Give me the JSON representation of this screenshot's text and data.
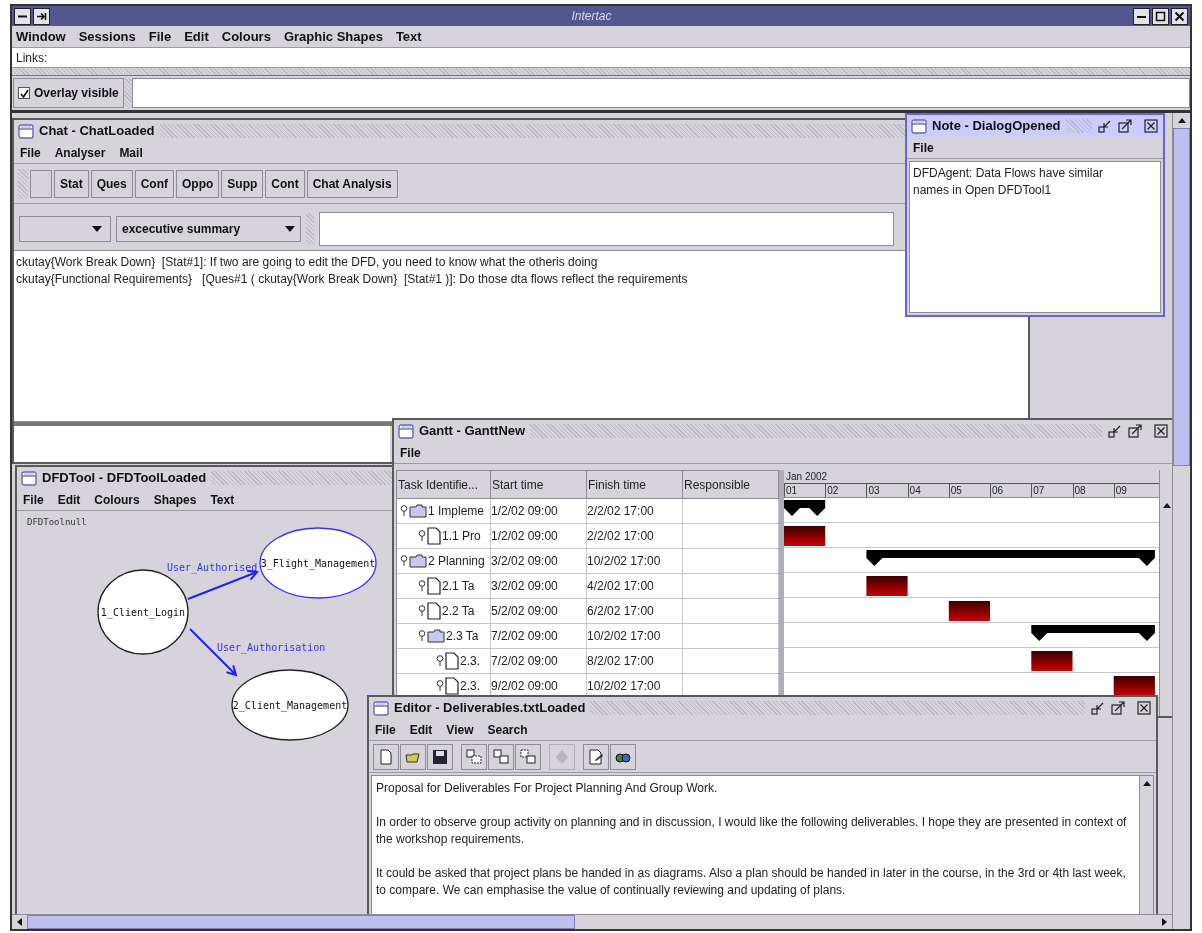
{
  "window": {
    "title": "Intertac"
  },
  "menu": [
    "Window",
    "Sessions",
    "File",
    "Edit",
    "Colours",
    "Graphic Shapes",
    "Text"
  ],
  "links": {
    "label": "Links:"
  },
  "overlay": {
    "label": "Overlay visible",
    "checked": true
  },
  "chat": {
    "title": "Chat - ChatLoaded",
    "active": false,
    "menu": [
      "File",
      "Analyser",
      "Mail"
    ],
    "toolbar": [
      {
        "kind": "blank"
      },
      {
        "kind": "text",
        "label": "Stat"
      },
      {
        "kind": "text",
        "label": "Ques"
      },
      {
        "kind": "text",
        "label": "Conf"
      },
      {
        "kind": "text",
        "label": "Oppo"
      },
      {
        "kind": "text",
        "label": "Supp"
      },
      {
        "kind": "text",
        "label": "Cont"
      },
      {
        "kind": "text",
        "label": "Chat Analysis"
      }
    ],
    "combos": [
      {
        "kind": "blank"
      },
      {
        "kind": "text",
        "value": "excecutive summary"
      }
    ],
    "messages": [
      "ckutay{Work Break Down}  [Stat#1]: If two are going to edit the DFD, you need to know what the otheris doing",
      "ckutay{Functional Requirements}   [Ques#1 ( ckutay{Work Break Down}  [Stat#1 )]: Do those dta flows reflect the requirements"
    ]
  },
  "note": {
    "title": "Note - DialogOpened",
    "active": true,
    "controls_shown": true,
    "menu": [
      "File"
    ],
    "text": "DFDAgent: Data Flows have similar names in Open DFDTool1"
  },
  "dfd": {
    "title": "DFDTool - DFDToolLoaded",
    "active": false,
    "menu": [
      "File",
      "Edit",
      "Colours",
      "Shapes",
      "Text"
    ],
    "canvas_label": "DFDToolnull",
    "nodes": [
      {
        "label": "1_Client_Login",
        "selected": false
      },
      {
        "label": "3_Flight_Management",
        "selected": true
      },
      {
        "label": "2_Client_Management",
        "selected": false
      }
    ],
    "flows": [
      {
        "label": "User_Authorised"
      },
      {
        "label": "User_Authorisation"
      }
    ]
  },
  "gantt": {
    "title": "Gantt - GanttNew",
    "active": false,
    "controls_shown": true,
    "menu": [
      "File"
    ],
    "columns": [
      "Task Identifie...",
      "Start time",
      "Finish time",
      "Responsible"
    ],
    "rows": [
      {
        "label": "1 Impleme",
        "kind": "folder",
        "start": "1/2/02 09:00",
        "finish": "2/2/02 17:00",
        "children": [
          {
            "label": "1.1 Pro",
            "kind": "task",
            "start": "1/2/02 09:00",
            "finish": "2/2/02 17:00"
          }
        ]
      },
      {
        "label": "2 Planning",
        "kind": "folder",
        "start": "3/2/02 09:00",
        "finish": "10/2/02 17:00",
        "children": [
          {
            "label": "2.1 Ta",
            "kind": "task",
            "start": "3/2/02 09:00",
            "finish": "4/2/02 17:00"
          },
          {
            "label": "2.2 Ta",
            "kind": "task",
            "start": "5/2/02 09:00",
            "finish": "6/2/02 17:00"
          },
          {
            "label": "2.3 Ta",
            "kind": "folder",
            "start": "7/2/02 09:00",
            "finish": "10/2/02 17:00",
            "children": [
              {
                "label": "2.3.",
                "kind": "task",
                "start": "7/2/02 09:00",
                "finish": "8/2/02 17:00"
              },
              {
                "label": "2.3.",
                "kind": "task",
                "start": "9/2/02 09:00",
                "finish": "10/2/02 17:00"
              }
            ]
          }
        ]
      }
    ],
    "timeline": {
      "month": "Jan 2002",
      "days": [
        "01",
        "02",
        "03",
        "04",
        "05",
        "06",
        "07",
        "08",
        "09"
      ]
    }
  },
  "editor": {
    "title": "Editor - Deliverables.txtLoaded",
    "active": false,
    "controls_shown": true,
    "menu": [
      "File",
      "Edit",
      "View",
      "Search"
    ],
    "toolbar_groups": [
      [
        {
          "kind": "new",
          "disabled": false
        },
        {
          "kind": "open",
          "disabled": false
        },
        {
          "kind": "save",
          "disabled": false
        }
      ],
      [
        {
          "kind": "copy",
          "disabled": false
        },
        {
          "kind": "cut",
          "disabled": false
        },
        {
          "kind": "paste",
          "disabled": false
        }
      ],
      [
        {
          "kind": "move",
          "disabled": true
        }
      ],
      [
        {
          "kind": "edit",
          "disabled": false
        },
        {
          "kind": "find",
          "disabled": false
        }
      ]
    ],
    "paragraphs": [
      "Proposal for Deliverables For Project Planning And Group Work.",
      "In order to observe group activity on planning and in discussion, I would like the following deliverables. I hope they are presented in context of the workshop requirements.",
      "It could be asked that project plans be handed in as diagrams. Also a plan should be handed in later in the course, in the 3rd or 4th last week, to compare. We can emphasise the value of continually reviewing and updating of plans."
    ]
  }
}
